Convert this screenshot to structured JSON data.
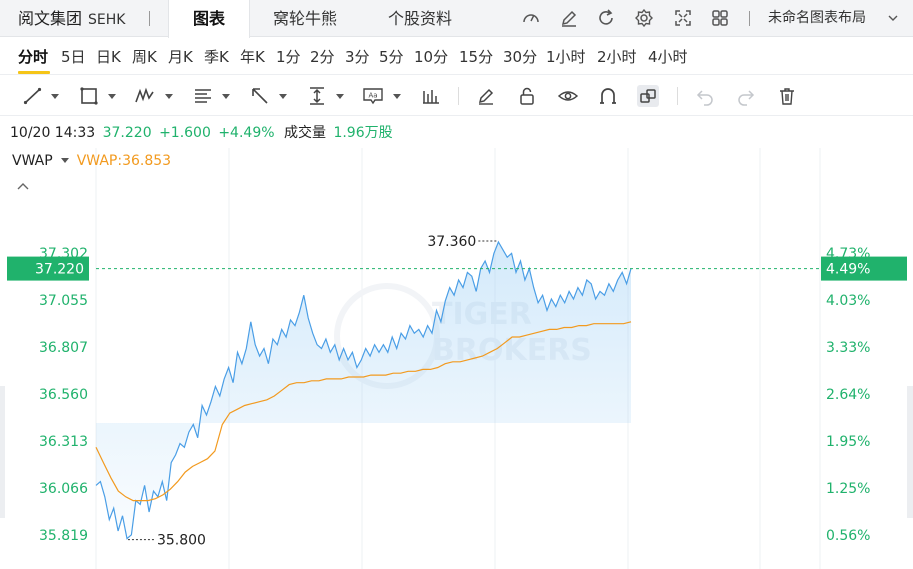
{
  "tabbar": {
    "stock_name": "阅文集团",
    "stock_code": "SEHK",
    "tabs": [
      "图表",
      "窝轮牛熊",
      "个股资料"
    ],
    "active_tab": "图表",
    "layout_name": "未命名图表布局",
    "icons": [
      "speedometer-icon",
      "pencil-icon",
      "refresh-icon",
      "settings-icon",
      "fullscreen-icon",
      "grid-layout-icon"
    ]
  },
  "periods": {
    "items": [
      "分时",
      "5日",
      "日K",
      "周K",
      "月K",
      "季K",
      "年K",
      "1分",
      "2分",
      "3分",
      "5分",
      "10分",
      "15分",
      "30分",
      "1小时",
      "2小时",
      "4小时"
    ],
    "active": "分时"
  },
  "tools": {
    "icons": [
      "trend-line-icon",
      "rectangle-icon",
      "pattern-icon",
      "fib-retracement-icon",
      "arrow-icon",
      "measure-icon",
      "text-annotation-icon",
      "indicators-icon",
      "brush-icon",
      "lock-icon",
      "eye-icon",
      "magnet-icon",
      "sync-icon",
      "undo-icon",
      "redo-icon",
      "delete-icon"
    ]
  },
  "quote": {
    "time": "10/20 14:33",
    "price": "37.220",
    "change": "+1.600",
    "change_pct": "+4.49%",
    "volume_label": "成交量",
    "volume": "1.96万股"
  },
  "indicator": {
    "name": "VWAP",
    "value_text": "VWAP:36.853"
  },
  "colors": {
    "price_line": "#4a9ee6",
    "vwap_line": "#f29a1f",
    "up_green": "#20b26c",
    "current_price_tag": "#20b26c"
  },
  "chart_data": {
    "type": "line",
    "ylim": [
      35.7,
      37.5
    ],
    "price_ticks": [
      "35.819",
      "36.066",
      "36.313",
      "36.560",
      "36.807",
      "37.055",
      "37.302"
    ],
    "pct_ticks": [
      "0.56%",
      "1.25%",
      "1.95%",
      "2.64%",
      "3.33%",
      "4.03%",
      "4.73%"
    ],
    "current_price": "37.220",
    "current_pct": "4.49%",
    "high_label": "37.360",
    "high_value": 37.36,
    "low_label": "35.800",
    "low_value": 35.8,
    "watermark": [
      "TIGER",
      "BROKERS"
    ],
    "series": [
      {
        "name": "",
        "values": [
          36.08,
          36.1,
          36.02,
          35.9,
          35.96,
          35.84,
          35.92,
          35.8,
          35.82,
          36.0,
          35.98,
          36.08,
          35.94,
          36.05,
          36.02,
          36.1,
          36.0,
          36.2,
          36.24,
          36.3,
          36.28,
          36.36,
          36.4,
          36.33,
          36.5,
          36.45,
          36.52,
          36.6,
          36.55,
          36.64,
          36.7,
          36.62,
          36.78,
          36.72,
          36.8,
          36.94,
          36.82,
          36.76,
          36.8,
          36.72,
          36.85,
          36.82,
          36.9,
          36.86,
          36.95,
          36.92,
          36.99,
          37.08,
          36.96,
          36.88,
          36.82,
          36.8,
          36.85,
          36.78,
          36.82,
          36.74,
          36.8,
          36.74,
          36.78,
          36.7,
          36.74,
          36.8,
          36.76,
          36.82,
          36.78,
          36.82,
          36.78,
          36.86,
          36.8,
          36.88,
          36.85,
          36.92,
          36.88,
          36.9,
          36.86,
          36.92,
          36.88,
          37.0,
          36.94,
          37.05,
          37.12,
          37.08,
          37.16,
          37.12,
          37.2,
          37.18,
          37.1,
          37.22,
          37.26,
          37.2,
          37.3,
          37.36,
          37.32,
          37.28,
          37.3,
          37.2,
          37.26,
          37.16,
          37.22,
          37.12,
          37.04,
          37.08,
          37.0,
          37.06,
          37.02,
          37.08,
          37.04,
          37.1,
          37.06,
          37.12,
          37.08,
          37.16,
          37.14,
          37.06,
          37.1,
          37.08,
          37.14,
          37.1,
          37.16,
          37.2,
          37.14,
          37.22
        ]
      },
      {
        "name": "VWAP",
        "values": [
          36.28,
          36.2,
          36.12,
          36.05,
          36.02,
          36.0,
          36.0,
          36.0,
          36.01,
          36.03,
          36.06,
          36.1,
          36.15,
          36.18,
          36.2,
          36.22,
          36.26,
          36.4,
          36.46,
          36.48,
          36.5,
          36.51,
          36.52,
          36.53,
          36.55,
          36.58,
          36.61,
          36.62,
          36.62,
          36.63,
          36.63,
          36.64,
          36.64,
          36.64,
          36.65,
          36.65,
          36.65,
          36.66,
          36.66,
          36.66,
          36.67,
          36.67,
          36.68,
          36.68,
          36.69,
          36.69,
          36.7,
          36.72,
          36.73,
          36.73,
          36.74,
          36.75,
          36.76,
          36.78,
          36.8,
          36.83,
          36.86,
          36.86,
          36.87,
          36.88,
          36.89,
          36.9,
          36.9,
          36.91,
          36.91,
          36.92,
          36.92,
          36.93,
          36.93,
          36.93,
          36.93,
          36.93,
          36.94
        ]
      }
    ]
  }
}
